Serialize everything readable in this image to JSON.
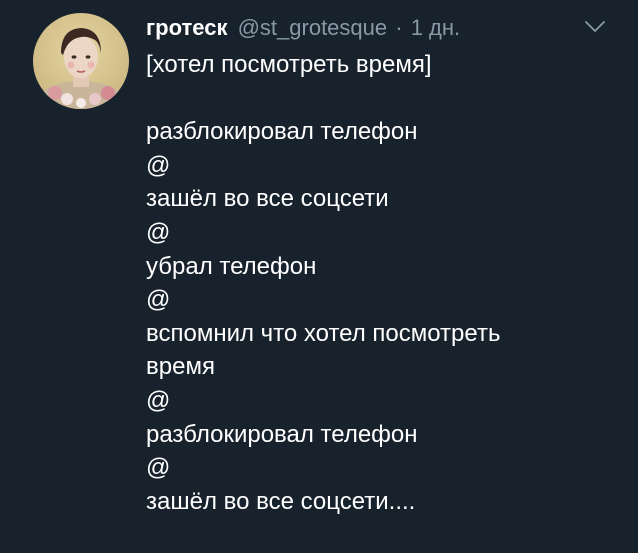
{
  "tweet": {
    "display_name": "гротеск",
    "handle": "@st_grotesque",
    "separator": "·",
    "time": "1 дн.",
    "lines": [
      "[хотел посмотреть время]",
      "",
      "разблокировал телефон",
      "@",
      "зашёл во все соцсети",
      "@",
      "убрал телефон",
      "@",
      "вспомнил что хотел посмотреть",
      "время",
      "@",
      "разблокировал телефон",
      "@",
      "зашёл во все соцсети...."
    ]
  },
  "icons": {
    "caret": "chevron-down-icon",
    "avatar": "avatar"
  },
  "colors": {
    "background": "#18222d",
    "text": "#ffffff",
    "secondary": "#8899a6"
  }
}
